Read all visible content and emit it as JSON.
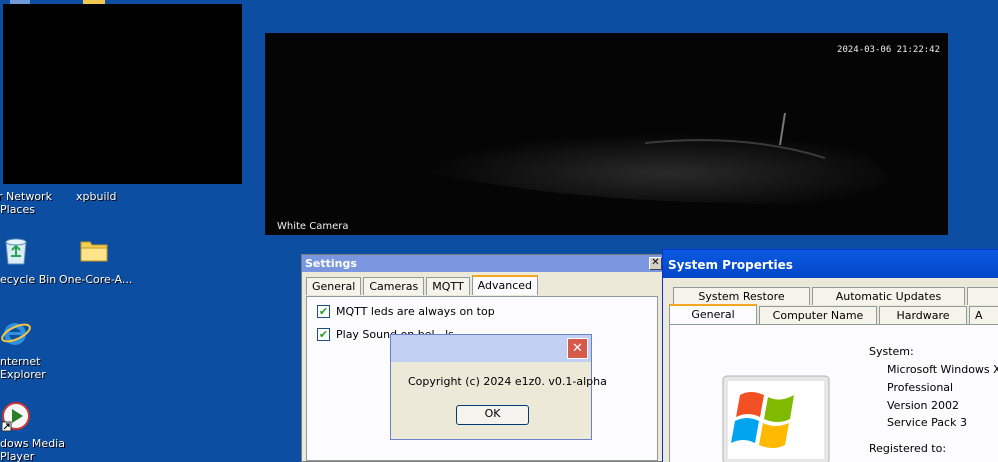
{
  "desktop": {
    "icons": [
      {
        "label_lines": [
          "r Network",
          "Places"
        ],
        "icon": "network-places-icon"
      },
      {
        "label_lines": [
          "xpbuild"
        ],
        "icon": "folder-icon"
      },
      {
        "label_lines": [
          "ecycle Bin"
        ],
        "icon": "recycle-bin-icon"
      },
      {
        "label_lines": [
          "One-Core-A..."
        ],
        "icon": "folder-icon"
      },
      {
        "label_lines": [
          "nternet",
          "Explorer"
        ],
        "icon": "internet-explorer-icon"
      },
      {
        "label_lines": [
          "dows Media",
          "Player"
        ],
        "icon": "windows-media-player-icon"
      }
    ]
  },
  "camera": {
    "timestamp": "2024-03-06 21:22:42",
    "name": "White Camera"
  },
  "settings": {
    "title": "Settings",
    "tabs": [
      "General",
      "Cameras",
      "MQTT",
      "Advanced"
    ],
    "active_tab": "Advanced",
    "options": [
      {
        "label": "MQTT leds are always on top",
        "checked": true
      },
      {
        "label": "Play Sound on bel...ls",
        "checked": true
      }
    ]
  },
  "about": {
    "message": "Copyright (c) 2024 e1z0. v0.1-alpha",
    "ok_label": "OK"
  },
  "system_properties": {
    "title": "System Properties",
    "tabs_back": [
      "System Restore",
      "Automatic Updates"
    ],
    "tabs_front": [
      "General",
      "Computer Name",
      "Hardware",
      "A"
    ],
    "active_tab": "General",
    "system_heading": "System:",
    "system_lines": [
      "Microsoft Windows XP",
      "Professional",
      "Version 2002",
      "Service Pack 3"
    ],
    "registered_heading": "Registered to:"
  },
  "colors": {
    "desktop": "#0b4ea2",
    "titlebar_active": "#0a5ae0",
    "titlebar_inactive": "#7a96df"
  }
}
